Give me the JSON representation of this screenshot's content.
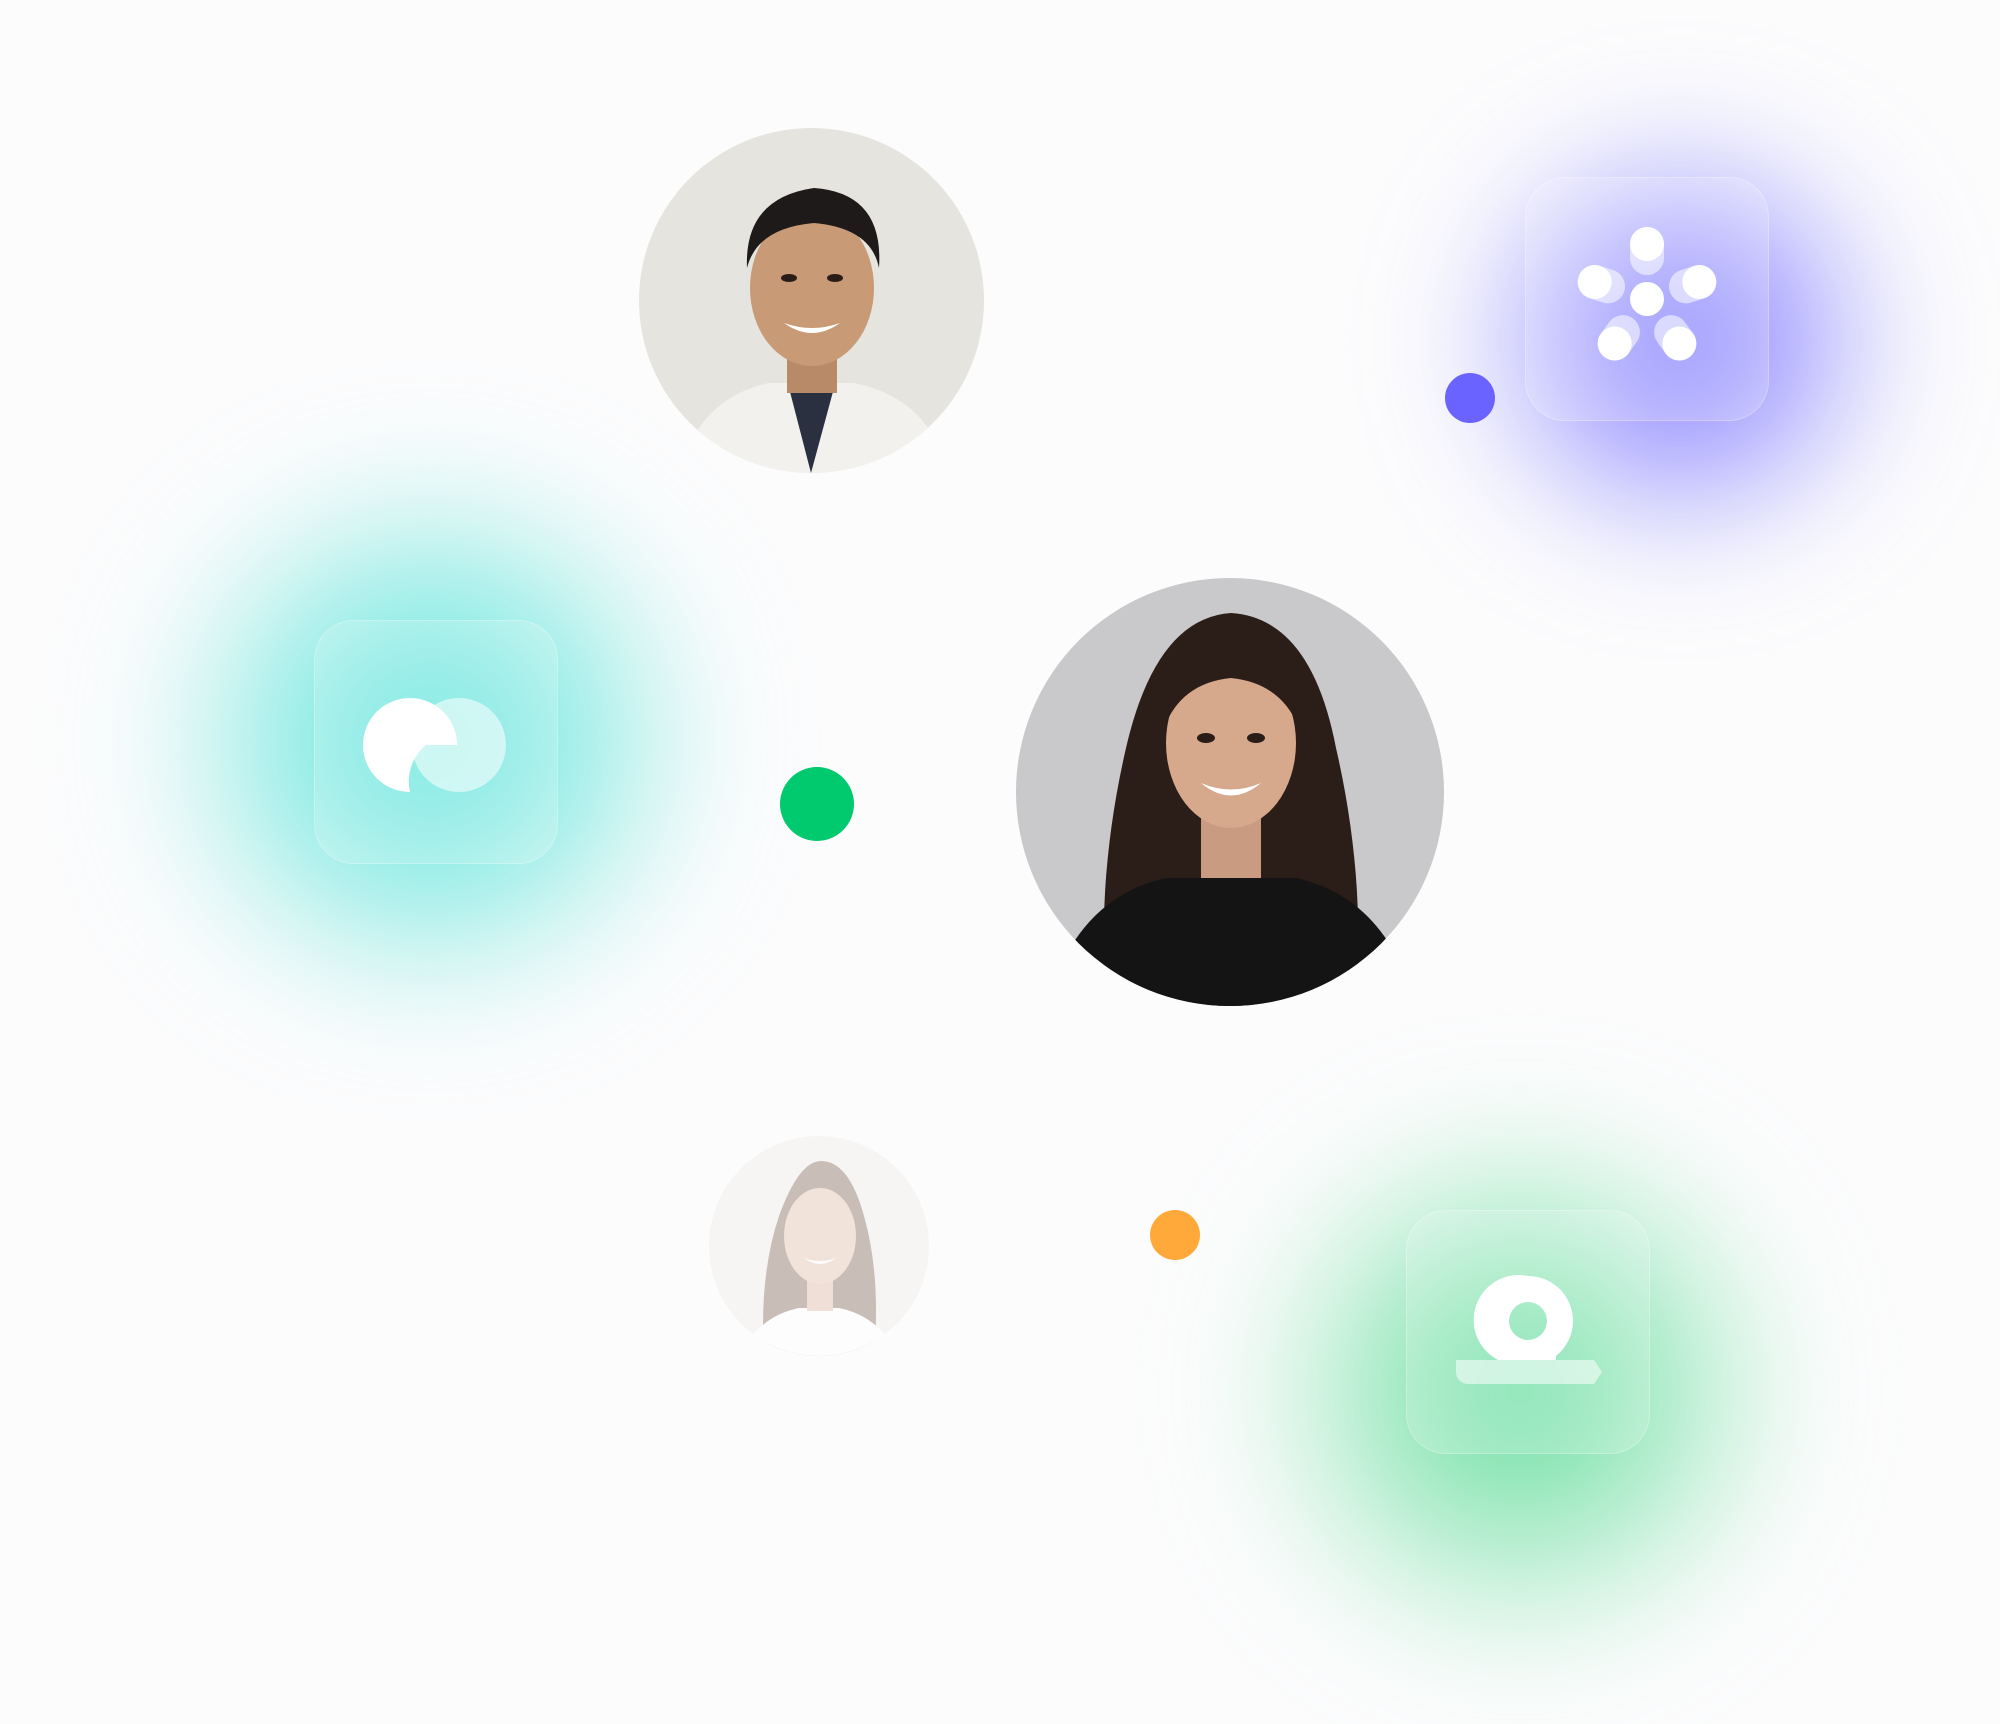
{
  "colors": {
    "background": "#fcfcfd",
    "accent_purple": "#6a63ff",
    "accent_teal": "#4fe2d6",
    "accent_green": "#00c96e",
    "accent_orange": "#ffa93a",
    "tile_glyph": "#ffffff"
  },
  "avatars": [
    {
      "name": "man-portrait",
      "bg": "#e6e4df"
    },
    {
      "name": "woman-curly-hair-portrait",
      "bg": "#c9c8ca"
    },
    {
      "name": "woman-faded-portrait",
      "bg": "#ece9e6"
    }
  ],
  "tiles": [
    {
      "icon": "asterisk-dots-logo-icon",
      "accent": "#6a63ff"
    },
    {
      "icon": "overlapping-circles-logo-icon",
      "accent": "#4fe2d6"
    },
    {
      "icon": "ring-on-base-logo-icon",
      "accent": "#00c96e"
    }
  ],
  "dots": [
    {
      "color": "#6a63ff"
    },
    {
      "color": "#00c96e"
    },
    {
      "color": "#ffa93a"
    }
  ]
}
